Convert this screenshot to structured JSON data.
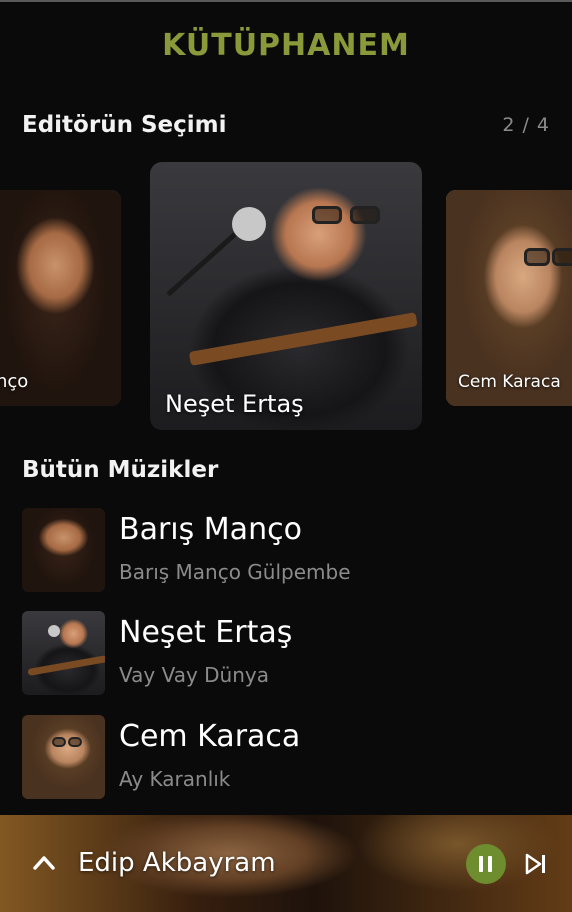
{
  "header": {
    "title": "KÜTÜPHANEM"
  },
  "editor_picks": {
    "heading": "Editörün Seçimi",
    "pager": "2 / 4",
    "cards": [
      {
        "label": "nço",
        "artist": "Barış Manço"
      },
      {
        "label": "Neşet Ertaş",
        "artist": "Neşet Ertaş",
        "active": true
      },
      {
        "label": "Cem Karaca",
        "artist": "Cem Karaca"
      }
    ]
  },
  "all_music": {
    "heading": "Bütün Müzikler",
    "tracks": [
      {
        "artist": "Barış Manço",
        "song": "Barış Manço Gülpembe"
      },
      {
        "artist": "Neşet Ertaş",
        "song": "Vay Vay Dünya"
      },
      {
        "artist": "Cem Karaca",
        "song": "Ay Karanlık"
      }
    ]
  },
  "player": {
    "now_playing": "Edip Akbayram",
    "state": "playing",
    "icons": [
      "chevron-up-icon",
      "pause-icon",
      "skip-next-icon"
    ]
  },
  "colors": {
    "accent": "#8a9a3a",
    "play_button": "#6e8d2e",
    "background": "#0a0a0a",
    "subtext": "#8b8b8b"
  }
}
